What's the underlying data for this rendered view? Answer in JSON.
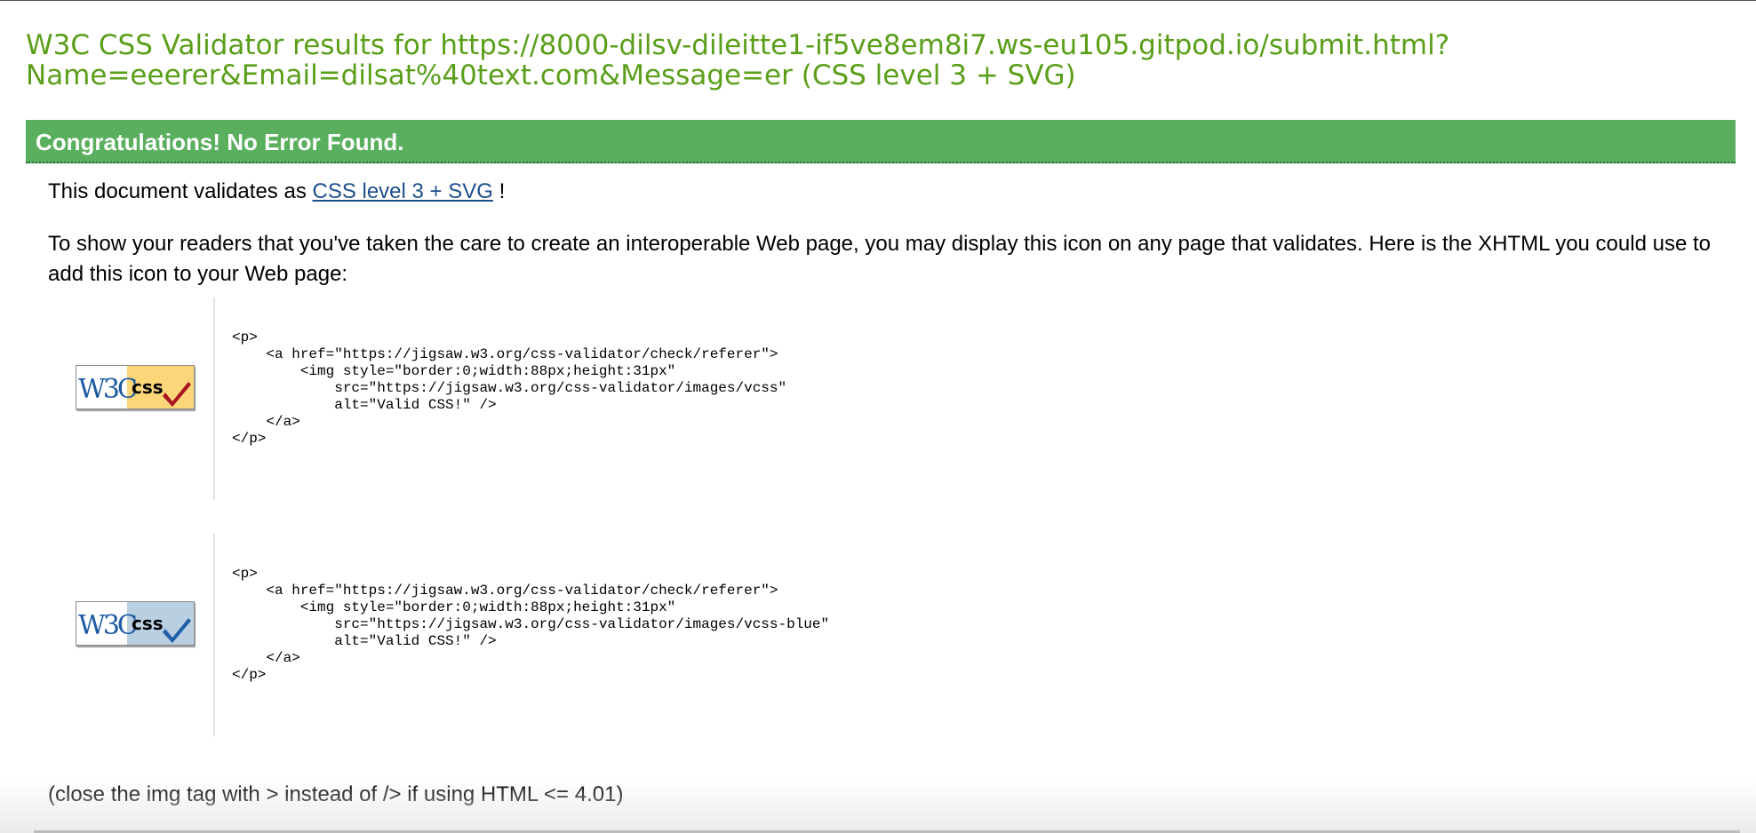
{
  "page": {
    "title": "W3C CSS Validator results for https://8000-dilsv-dileitte1-if5ve8em8i7.ws-eu105.gitpod.io/submit.html?Name=eeerer&Email=dilsat%40text.com&Message=er (CSS level 3 + SVG)"
  },
  "banner": {
    "text": "Congratulations! No Error Found."
  },
  "validates": {
    "prefix": "This document validates as ",
    "link": "CSS level 3 + SVG",
    "suffix": " !"
  },
  "intro": "To show your readers that you've taken the care to create an interoperable Web page, you may display this icon on any page that validates. Here is the XHTML you could use to add this icon to your Web page:",
  "badges": [
    {
      "icon": "w3c-css-badge-gold-icon",
      "w3c_text": "W3C",
      "css_text": "css",
      "panel_color": "#fdd67a",
      "check_color": "#a8141d",
      "code": "<p>\n    <a href=\"https://jigsaw.w3.org/css-validator/check/referer\">\n        <img style=\"border:0;width:88px;height:31px\"\n            src=\"https://jigsaw.w3.org/css-validator/images/vcss\"\n            alt=\"Valid CSS!\" />\n    </a>\n</p>"
    },
    {
      "icon": "w3c-css-badge-blue-icon",
      "w3c_text": "W3C",
      "css_text": "css",
      "panel_color": "#b9cfe2",
      "check_color": "#1f5fa8",
      "code": "<p>\n    <a href=\"https://jigsaw.w3.org/css-validator/check/referer\">\n        <img style=\"border:0;width:88px;height:31px\"\n            src=\"https://jigsaw.w3.org/css-validator/images/vcss-blue\"\n            alt=\"Valid CSS!\" />\n    </a>\n</p>"
    }
  ],
  "footnote": "(close the img tag with > instead of /> if using HTML <= 4.01)",
  "colors": {
    "title": "#5a9e1a",
    "banner": "#5aaf5f",
    "link": "#1d4f8c"
  }
}
